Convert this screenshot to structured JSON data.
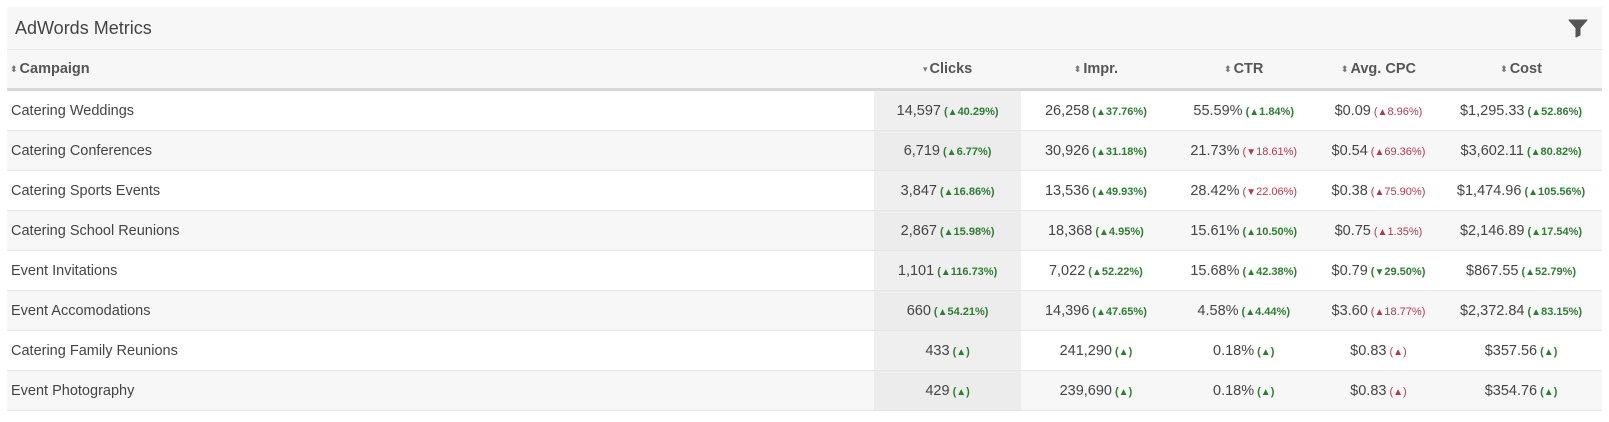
{
  "widget": {
    "title": "AdWords Metrics",
    "filter_icon": "filter-icon"
  },
  "columns": [
    {
      "key": "campaign",
      "label": "Campaign",
      "sort_icon": "sort-both-icon"
    },
    {
      "key": "clicks",
      "label": "Clicks",
      "sort_icon": "sort-desc-icon"
    },
    {
      "key": "impr",
      "label": "Impr.",
      "sort_icon": "sort-both-icon"
    },
    {
      "key": "ctr",
      "label": "CTR",
      "sort_icon": "sort-both-icon"
    },
    {
      "key": "cpc",
      "label": "Avg. CPC",
      "sort_icon": "sort-both-icon"
    },
    {
      "key": "cost",
      "label": "Cost",
      "sort_icon": "sort-both-icon"
    }
  ],
  "colors": {
    "up": "#2e7d32",
    "down": "#b03a4c"
  },
  "rows": [
    {
      "campaign": "Catering Weddings",
      "clicks": {
        "value": "14,597",
        "change": "40.29%",
        "dir": "up"
      },
      "impr": {
        "value": "26,258",
        "change": "37.76%",
        "dir": "up"
      },
      "ctr": {
        "value": "55.59%",
        "change": "1.84%",
        "dir": "up"
      },
      "cpc": {
        "value": "$0.09",
        "change": "8.96%",
        "dir": "up-bad"
      },
      "cost": {
        "value": "$1,295.33",
        "change": "52.86%",
        "dir": "up"
      }
    },
    {
      "campaign": "Catering Conferences",
      "clicks": {
        "value": "6,719",
        "change": "6.77%",
        "dir": "up"
      },
      "impr": {
        "value": "30,926",
        "change": "31.18%",
        "dir": "up"
      },
      "ctr": {
        "value": "21.73%",
        "change": "18.61%",
        "dir": "down-bad"
      },
      "cpc": {
        "value": "$0.54",
        "change": "69.36%",
        "dir": "up-bad"
      },
      "cost": {
        "value": "$3,602.11",
        "change": "80.82%",
        "dir": "up"
      }
    },
    {
      "campaign": "Catering Sports Events",
      "clicks": {
        "value": "3,847",
        "change": "16.86%",
        "dir": "up"
      },
      "impr": {
        "value": "13,536",
        "change": "49.93%",
        "dir": "up"
      },
      "ctr": {
        "value": "28.42%",
        "change": "22.06%",
        "dir": "down-bad"
      },
      "cpc": {
        "value": "$0.38",
        "change": "75.90%",
        "dir": "up-bad"
      },
      "cost": {
        "value": "$1,474.96",
        "change": "105.56%",
        "dir": "up"
      }
    },
    {
      "campaign": "Catering School Reunions",
      "clicks": {
        "value": "2,867",
        "change": "15.98%",
        "dir": "up"
      },
      "impr": {
        "value": "18,368",
        "change": "4.95%",
        "dir": "up"
      },
      "ctr": {
        "value": "15.61%",
        "change": "10.50%",
        "dir": "up"
      },
      "cpc": {
        "value": "$0.75",
        "change": "1.35%",
        "dir": "up-bad"
      },
      "cost": {
        "value": "$2,146.89",
        "change": "17.54%",
        "dir": "up"
      }
    },
    {
      "campaign": "Event Invitations",
      "clicks": {
        "value": "1,101",
        "change": "116.73%",
        "dir": "up"
      },
      "impr": {
        "value": "7,022",
        "change": "52.22%",
        "dir": "up"
      },
      "ctr": {
        "value": "15.68%",
        "change": "42.38%",
        "dir": "up"
      },
      "cpc": {
        "value": "$0.79",
        "change": "29.50%",
        "dir": "down-good"
      },
      "cost": {
        "value": "$867.55",
        "change": "52.79%",
        "dir": "up"
      }
    },
    {
      "campaign": "Event Accomodations",
      "clicks": {
        "value": "660",
        "change": "54.21%",
        "dir": "up"
      },
      "impr": {
        "value": "14,396",
        "change": "47.65%",
        "dir": "up"
      },
      "ctr": {
        "value": "4.58%",
        "change": "4.44%",
        "dir": "up"
      },
      "cpc": {
        "value": "$3.60",
        "change": "18.77%",
        "dir": "up-bad"
      },
      "cost": {
        "value": "$2,372.84",
        "change": "83.15%",
        "dir": "up"
      }
    },
    {
      "campaign": "Catering Family Reunions",
      "clicks": {
        "value": "433",
        "change": "",
        "dir": "up"
      },
      "impr": {
        "value": "241,290",
        "change": "",
        "dir": "up"
      },
      "ctr": {
        "value": "0.18%",
        "change": "",
        "dir": "up"
      },
      "cpc": {
        "value": "$0.83",
        "change": "",
        "dir": "up-bad"
      },
      "cost": {
        "value": "$357.56",
        "change": "",
        "dir": "up"
      }
    },
    {
      "campaign": "Event Photography",
      "clicks": {
        "value": "429",
        "change": "",
        "dir": "up"
      },
      "impr": {
        "value": "239,690",
        "change": "",
        "dir": "up"
      },
      "ctr": {
        "value": "0.18%",
        "change": "",
        "dir": "up"
      },
      "cpc": {
        "value": "$0.83",
        "change": "",
        "dir": "up-bad"
      },
      "cost": {
        "value": "$354.76",
        "change": "",
        "dir": "up"
      }
    }
  ]
}
